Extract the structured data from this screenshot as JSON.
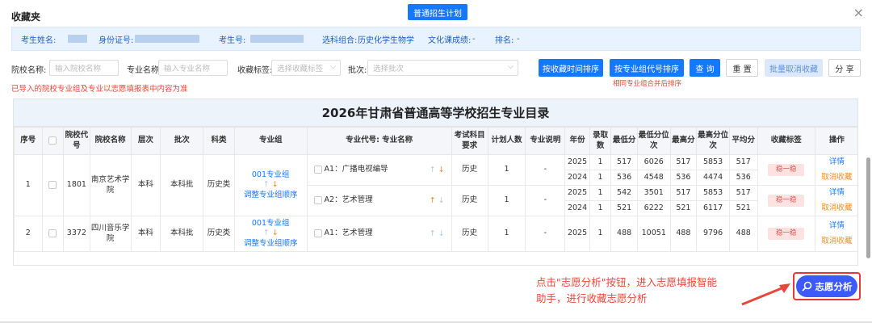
{
  "header": {
    "title": "收藏夹",
    "tab_label": "普通招生计划",
    "close": "×"
  },
  "info": {
    "name_label": "考生姓名:",
    "id_label": "身份证号:",
    "exam_no_label": "考生号:",
    "subjects_label": "选科组合:",
    "subjects_value": "历史化学生物学",
    "score_label": "文化课成绩:",
    "score_value": "-",
    "rank_label": "排名:",
    "rank_value": "-"
  },
  "filters": {
    "school_label": "院校名称:",
    "school_placeholder": "输入院校名称",
    "major_label": "专业名称:",
    "major_placeholder": "输入专业名称",
    "tag_label": "收藏标签:",
    "tag_placeholder": "选择收藏标签",
    "batch_label": "批次:",
    "batch_placeholder": "选择批次"
  },
  "buttons": {
    "sort_time": "按收藏时间排序",
    "sort_group": "按专业组代号排序",
    "query": "查 询",
    "reset": "重 置",
    "batch_cancel": "批量取消收藏",
    "share": "分 享",
    "group_hint": "相同专业组合并后排序"
  },
  "notice": "已导入的院校专业组及专业以志愿填报表中内容为准",
  "table": {
    "title": "2026年甘肃省普通高等学校招生专业目录",
    "headers": [
      "序号",
      "",
      "院校代号",
      "院校名称",
      "层次",
      "批次",
      "科类",
      "专业组",
      "专业代号: 专业名称",
      "考试科目要求",
      "计划人数",
      "专业说明",
      "年份",
      "录取数",
      "最低分",
      "最低分位次",
      "最高分",
      "最高分位次",
      "平均分",
      "收藏标签",
      "操作"
    ],
    "rows": [
      {
        "seq": "1",
        "code": "1801",
        "school": "南京艺术学院",
        "level": "本科",
        "batch": "本科批",
        "category": "历史类",
        "group": "001专业组",
        "group_adjust": "调整专业组顺序",
        "majors": [
          {
            "name": "A1：广播电视编导",
            "req": "历史",
            "plan": "1",
            "desc": "-",
            "years": [
              {
                "year": "2025",
                "admit": "1",
                "min": "517",
                "min_rank": "6026",
                "max": "517",
                "max_rank": "5853",
                "avg": "517"
              },
              {
                "year": "2024",
                "admit": "1",
                "min": "536",
                "min_rank": "4548",
                "max": "536",
                "max_rank": "4474",
                "avg": "536"
              }
            ],
            "tag": "稳一稳",
            "detail": "详情",
            "cancel": "取消收藏"
          },
          {
            "name": "A2：艺术管理",
            "req": "历史",
            "plan": "1",
            "desc": "-",
            "years": [
              {
                "year": "2025",
                "admit": "1",
                "min": "542",
                "min_rank": "3501",
                "max": "517",
                "max_rank": "5853",
                "avg": "517"
              },
              {
                "year": "2024",
                "admit": "1",
                "min": "521",
                "min_rank": "6222",
                "max": "521",
                "max_rank": "6117",
                "avg": "521"
              }
            ],
            "tag": "稳一稳",
            "detail": "详情",
            "cancel": "取消收藏"
          }
        ]
      },
      {
        "seq": "2",
        "code": "3372",
        "school": "四川音乐学院",
        "level": "本科",
        "batch": "本科批",
        "category": "历史类",
        "group": "001专业组",
        "group_adjust": "调整专业组顺序",
        "majors": [
          {
            "name": "A1：艺术管理",
            "req": "历史",
            "plan": "1",
            "desc": "-",
            "years": [
              {
                "year": "2025",
                "admit": "1",
                "min": "488",
                "min_rank": "10051",
                "max": "488",
                "max_rank": "9796",
                "avg": "488"
              }
            ],
            "tag": "稳一稳",
            "detail": "详情",
            "cancel": "取消收藏"
          }
        ]
      }
    ]
  },
  "annotation": {
    "line1": "点击\"志愿分析\"按钮，进入志愿填报智能",
    "line2": "助手，进行收藏志愿分析"
  },
  "analysis_button": "志愿分析",
  "colors": {
    "primary": "#1677ff",
    "annotation_red": "#e5483b",
    "analysis_bg": "#3d5afe"
  }
}
